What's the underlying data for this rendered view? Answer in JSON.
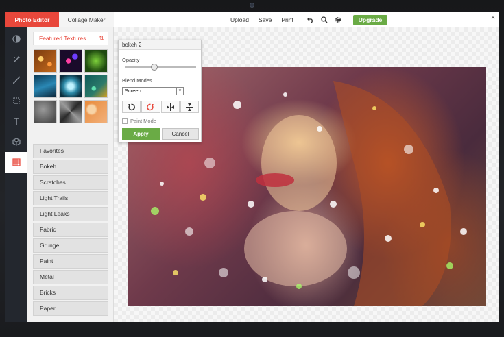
{
  "tabs": {
    "photo_editor": "Photo Editor",
    "collage_maker": "Collage Maker"
  },
  "toolbar": {
    "upload": "Upload",
    "save": "Save",
    "print": "Print",
    "upgrade": "Upgrade",
    "close": "×"
  },
  "rail_icons": [
    "contrast-icon",
    "magic-wand-icon",
    "brush-icon",
    "crop-icon",
    "text-icon",
    "sticker-icon",
    "texture-icon"
  ],
  "panel": {
    "heading": "Featured Textures",
    "categories": [
      "Favorites",
      "Bokeh",
      "Scratches",
      "Light Trails",
      "Light Leaks",
      "Fabric",
      "Grunge",
      "Paint",
      "Metal",
      "Bricks",
      "Paper"
    ]
  },
  "dialog": {
    "title": "bokeh 2",
    "minimize": "–",
    "opacity_label": "Opacity",
    "opacity_value": 0.4,
    "blend_modes_label": "Blend Modes",
    "blend_mode_selected": "Screen",
    "paint_mode_label": "Paint Mode",
    "apply_label": "Apply",
    "cancel_label": "Cancel"
  },
  "colors": {
    "accent_red": "#e8473b",
    "apply_green": "#6aab45",
    "rail_dark": "#23272e"
  }
}
